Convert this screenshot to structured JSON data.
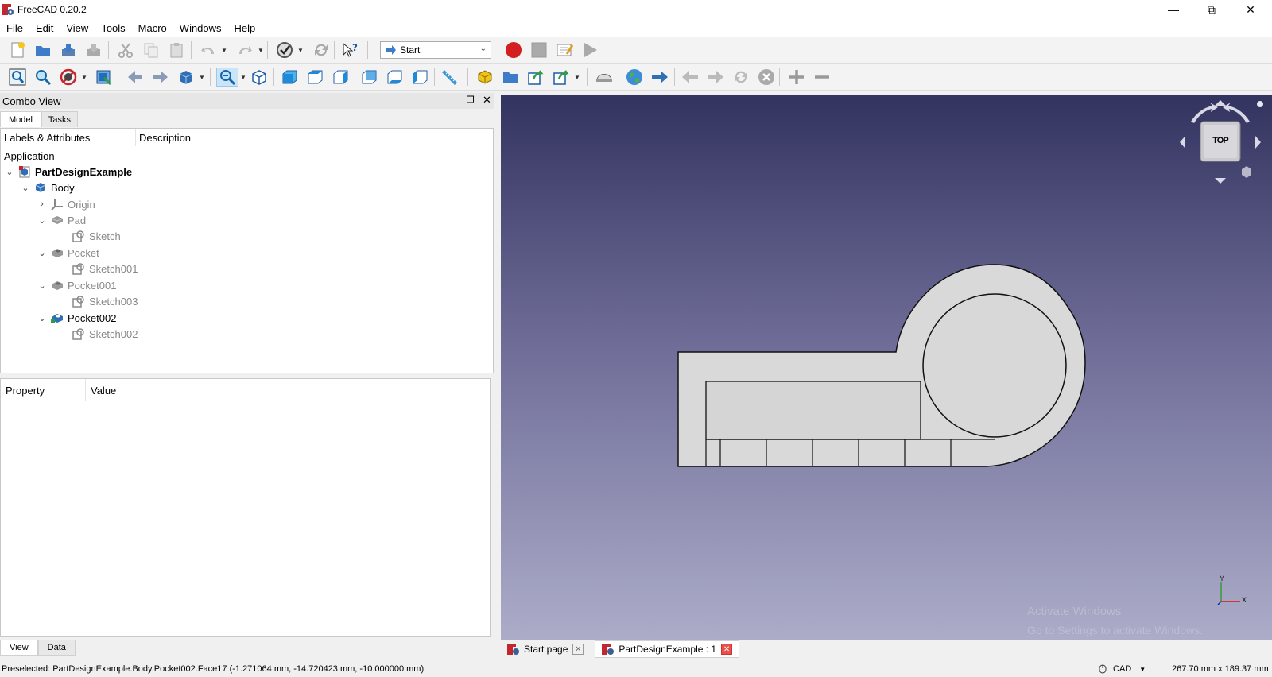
{
  "window": {
    "title": "FreeCAD 0.20.2"
  },
  "menu": [
    "File",
    "Edit",
    "View",
    "Tools",
    "Macro",
    "Windows",
    "Help"
  ],
  "workbench": {
    "selected": "Start"
  },
  "combo": {
    "title": "Combo View",
    "tabs": [
      "Model",
      "Tasks"
    ],
    "tree": {
      "columns": [
        "Labels & Attributes",
        "Description"
      ],
      "root_label": "Application",
      "items": [
        {
          "label": "PartDesignExample",
          "bold": true
        },
        {
          "label": "Body"
        },
        {
          "label": "Origin"
        },
        {
          "label": "Pad"
        },
        {
          "label": "Sketch"
        },
        {
          "label": "Pocket"
        },
        {
          "label": "Sketch001"
        },
        {
          "label": "Pocket001"
        },
        {
          "label": "Sketch003"
        },
        {
          "label": "Pocket002"
        },
        {
          "label": "Sketch002"
        }
      ]
    },
    "property_columns": [
      "Property",
      "Value"
    ],
    "bottom_tabs": [
      "View",
      "Data"
    ]
  },
  "navcube": {
    "face": "TOP"
  },
  "axis": {
    "x": "X",
    "y": "Y"
  },
  "doc_tabs": [
    "Start page",
    "PartDesignExample : 1"
  ],
  "watermark": {
    "line1": "Activate Windows",
    "line2": "Go to Settings to activate Windows."
  },
  "status": {
    "preselected": "Preselected: PartDesignExample.Body.Pocket002.Face17 (-1.271064 mm, -14.720423 mm, -10.000000 mm)",
    "nav_style": "CAD",
    "dimensions": "267.70 mm x 189.37 mm"
  },
  "colors": {
    "accent": "#0078d7",
    "record": "#d31f1f",
    "viewport_top": "#33335f",
    "viewport_bottom": "#acacc9"
  }
}
